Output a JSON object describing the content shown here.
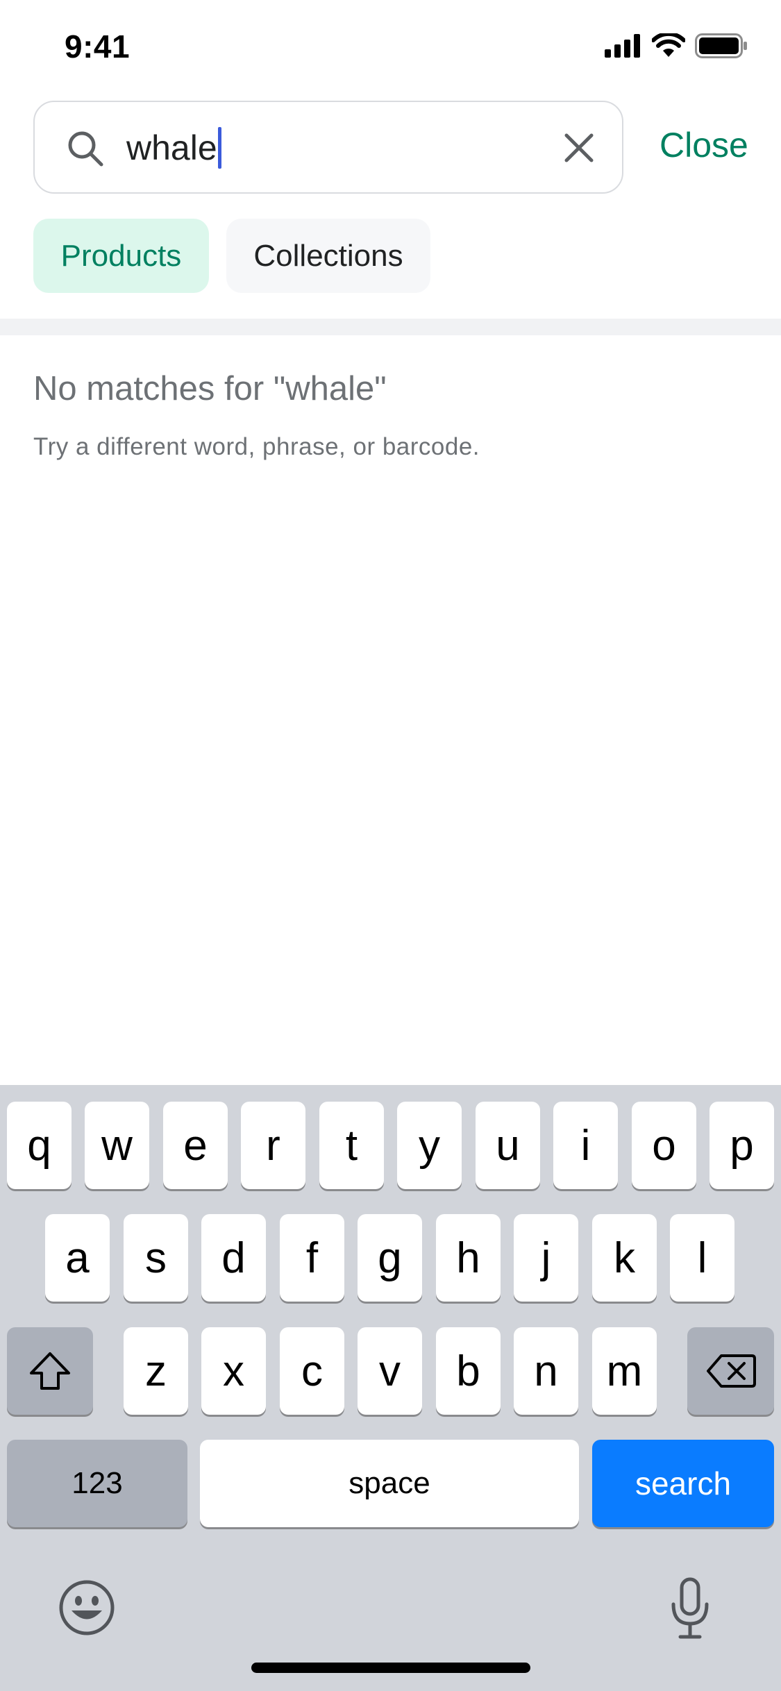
{
  "status_bar": {
    "time": "9:41",
    "icons": [
      "cellular-signal-icon",
      "wifi-icon",
      "battery-icon"
    ]
  },
  "search": {
    "value": "whale",
    "icon": "search-icon",
    "clear_icon": "close-icon",
    "close_label": "Close"
  },
  "tabs": [
    {
      "label": "Products",
      "selected": true
    },
    {
      "label": "Collections",
      "selected": false
    }
  ],
  "empty_state": {
    "title": "No matches for \"whale\"",
    "subtitle": "Try a different word, phrase, or barcode."
  },
  "keyboard": {
    "row1": [
      "q",
      "w",
      "e",
      "r",
      "t",
      "y",
      "u",
      "i",
      "o",
      "p"
    ],
    "row2": [
      "a",
      "s",
      "d",
      "f",
      "g",
      "h",
      "j",
      "k",
      "l"
    ],
    "row3": [
      "z",
      "x",
      "c",
      "v",
      "b",
      "n",
      "m"
    ],
    "shift_icon": "shift-icon",
    "backspace_icon": "backspace-icon",
    "numbers_label": "123",
    "space_label": "space",
    "search_label": "search",
    "emoji_icon": "emoji-icon",
    "mic_icon": "microphone-icon"
  },
  "colors": {
    "accent": "#008060",
    "tab_selected_bg": "#dcf7ec",
    "keyboard_bg": "#d1d4da",
    "search_key": "#0a7cff",
    "caret": "#3b5bdb"
  }
}
